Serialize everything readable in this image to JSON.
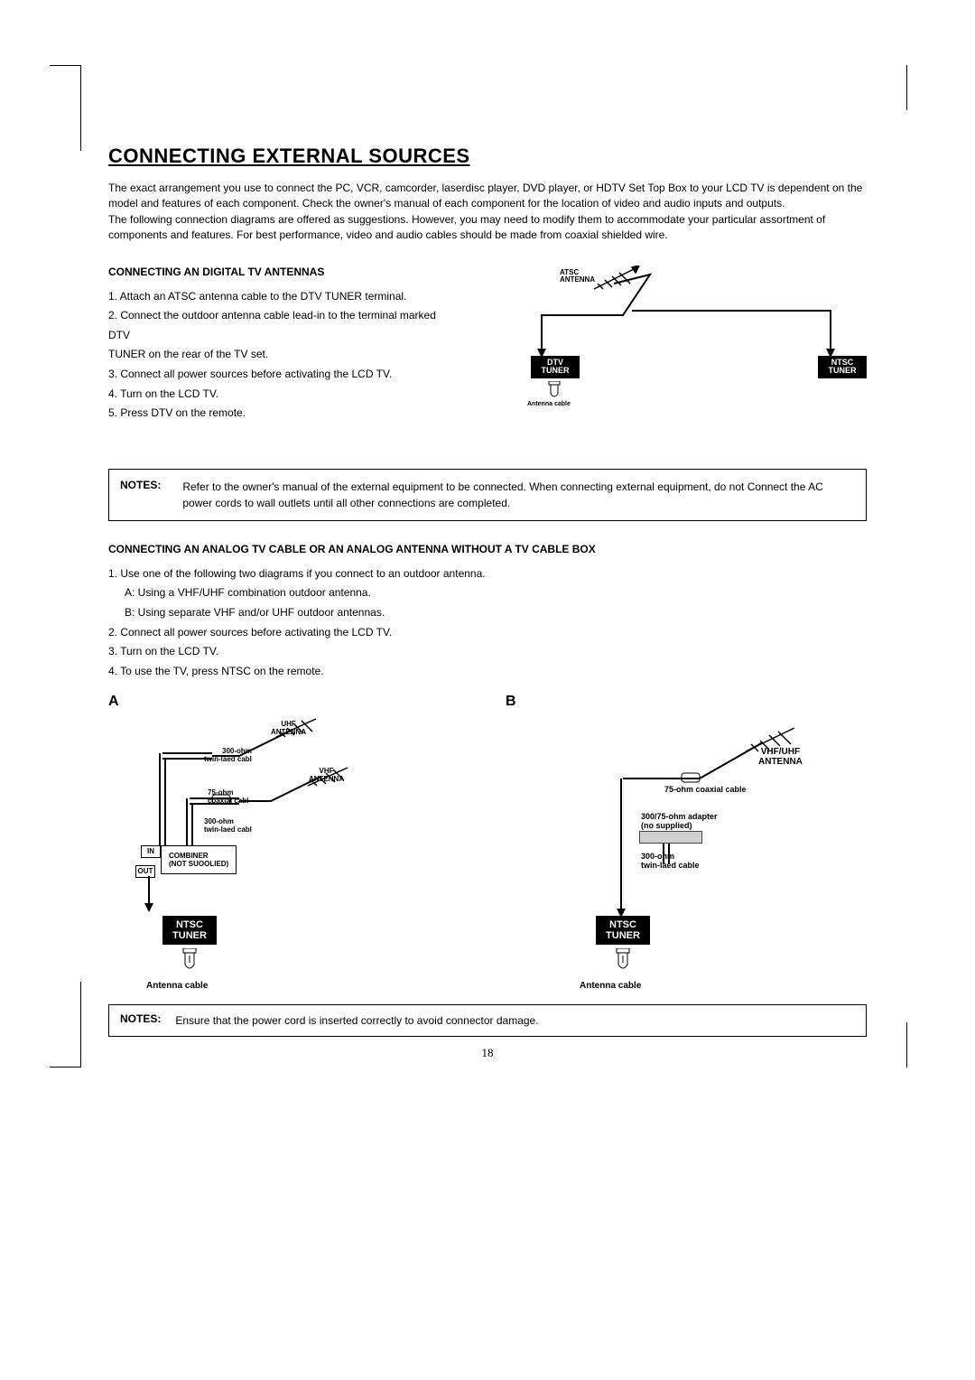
{
  "page_number": "18",
  "title": "CONNECTING EXTERNAL SOURCES",
  "intro": {
    "p1": "The exact arrangement you use to connect the PC, VCR, camcorder, laserdisc player, DVD player, or HDTV Set Top Box to your LCD TV is dependent on the model and features of each component. Check the owner's manual of each component for the location of video and audio inputs and outputs.",
    "p2": "The following connection diagrams are offered as suggestions. However, you may need to modify them to accommodate your particular assortment of components and features. For best performance, video and audio cables should be made from coaxial shielded wire."
  },
  "digital": {
    "heading": "CONNECTING AN DIGITAL TV ANTENNAS",
    "items": [
      "1. Attach an ATSC antenna cable to the DTV TUNER terminal.",
      "2. Connect the outdoor antenna cable lead-in to the terminal marked DTV",
      "TUNER on the rear of the TV set.",
      "3. Connect all power sources before activating the LCD TV.",
      "4. Turn on the LCD TV.",
      "5. Press DTV on the remote."
    ]
  },
  "diag_top": {
    "atsc_antenna": "ATSC\nANTENNA",
    "dtv_tuner": "DTV\nTUNER",
    "ntsc_tuner": "NTSC\nTUNER",
    "antenna_cable": "Antenna cable"
  },
  "notes1": {
    "label": "NOTES:",
    "text": "Refer to the owner's manual of the external equipment to be connected. When connecting external equipment, do not Connect the AC power cords to wall outlets until all other connections are completed."
  },
  "analog": {
    "heading": "CONNECTING AN ANALOG TV CABLE OR AN ANALOG ANTENNA WITHOUT A TV CABLE BOX",
    "items": [
      "1. Use one of the following two diagrams if you connect to an outdoor antenna.",
      "A: Using a VHF/UHF combination outdoor antenna.",
      "B: Using separate VHF and/or UHF outdoor antennas.",
      "2. Connect all power sources before activating the LCD TV.",
      "3. Turn on the LCD TV.",
      "4. To use the TV, press NTSC on the remote."
    ]
  },
  "diag_a": {
    "label": "A",
    "uhf_antenna": "UHF\nANTENNA",
    "vhf_antenna": "VHF\nANTENNA",
    "twin_lead_1": "300-ohm\ntwin-laed cabl",
    "coax": "75-ohm\ncoaxial cabl",
    "twin_lead_2": "300-ohm\ntwin-laed cabl",
    "combiner": "COMBINER\n(NOT SUOOLIED)",
    "in": "IN",
    "out": "OUT",
    "ntsc_tuner": "NTSC\nTUNER",
    "antenna_cable": "Antenna cable"
  },
  "diag_b": {
    "label": "B",
    "vhf_uhf_antenna": "VHF/UHF\nANTENNA",
    "coax75": "75-ohm coaxial cable",
    "adapter": "300/75-ohm adapter\n(no supplied)",
    "twin_lead": "300-ohm\ntwin-laed cable",
    "ntsc_tuner": "NTSC\nTUNER",
    "antenna_cable": "Antenna cable"
  },
  "notes2": {
    "label": "NOTES:",
    "text": "Ensure that the power cord is inserted correctly to avoid connector damage."
  }
}
